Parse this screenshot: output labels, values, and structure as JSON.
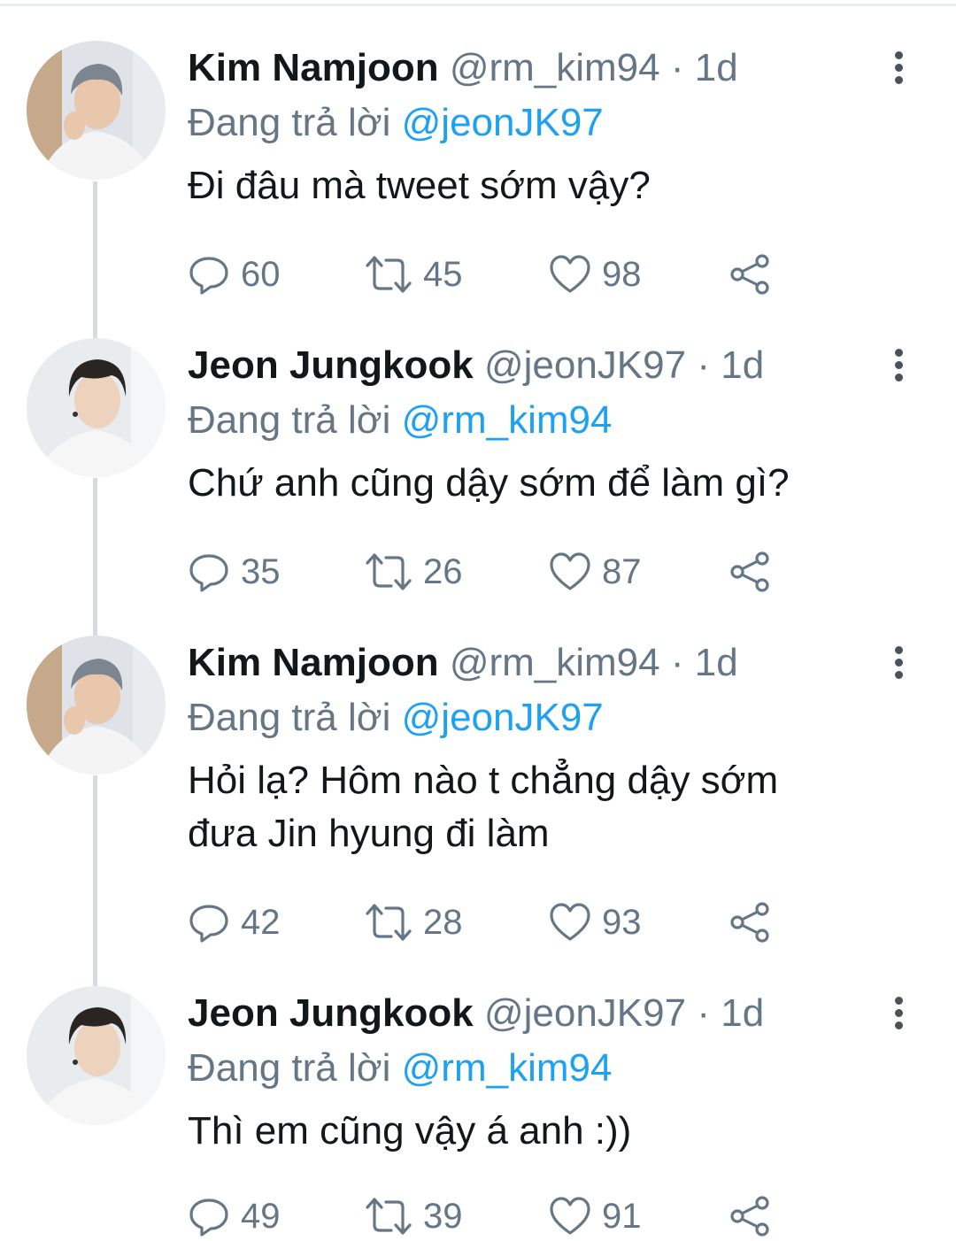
{
  "reply_prefix": "Đang trả lời",
  "separator": "·",
  "colors": {
    "name": "#14171a",
    "secondary": "#657786",
    "link": "#1da1f2",
    "thread_line": "#d5dbe0"
  },
  "tweets": [
    {
      "name": "Kim Namjoon",
      "handle": "@rm_kim94",
      "time": "1d",
      "replying_to": "@jeonJK97",
      "text": "Đi đâu mà tweet sớm vậy?",
      "replies": "60",
      "retweets": "45",
      "likes": "98"
    },
    {
      "name": "Jeon Jungkook",
      "handle": "@jeonJK97",
      "time": "1d",
      "replying_to": "@rm_kim94",
      "text": "Chứ anh cũng dậy sớm để làm gì?",
      "replies": "35",
      "retweets": "26",
      "likes": "87"
    },
    {
      "name": "Kim Namjoon",
      "handle": "@rm_kim94",
      "time": "1d",
      "replying_to": "@jeonJK97",
      "text_lines": [
        "Hỏi lạ? Hôm nào t chẳng dậy sớm",
        "đưa Jin hyung đi làm"
      ],
      "replies": "42",
      "retweets": "28",
      "likes": "93"
    },
    {
      "name": "Jeon Jungkook",
      "handle": "@jeonJK97",
      "time": "1d",
      "replying_to": "@rm_kim94",
      "text": "Thì em cũng vậy á anh :))",
      "replies": "49",
      "retweets": "39",
      "likes": "91"
    }
  ]
}
